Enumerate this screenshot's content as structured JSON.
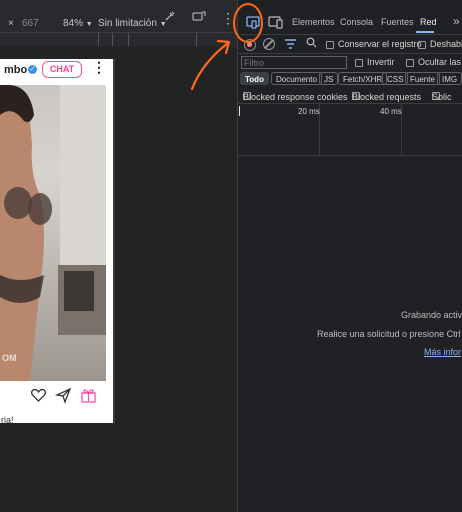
{
  "emulation_bar": {
    "close": "×",
    "width_value": "667",
    "zoom": "84%",
    "zoom_chevron": "▼",
    "throttle": "Sin limitación",
    "throttle_chevron": "▼",
    "more": "⋮"
  },
  "mobile_page": {
    "brand_text": "mbo",
    "chat_button": "CHAT",
    "more": "⋮",
    "watermark": "OM",
    "caption": "ria!",
    "colors": {
      "chat_accent": "#ff4fa3",
      "verified": "#3d8cf0"
    },
    "icons": [
      "heart-icon",
      "send-icon",
      "gift-icon"
    ]
  },
  "devtools": {
    "tabs": [
      {
        "label": "Elementos"
      },
      {
        "label": "Consola"
      },
      {
        "label": "Fuentes"
      },
      {
        "label": "Red",
        "active": true
      }
    ],
    "overflow": "»",
    "toolbar": {
      "preserve_log": "Conservar el registro",
      "disable_cache": "Deshabili"
    },
    "filter": {
      "placeholder": "Filtro",
      "invert": "Invertir",
      "hide": "Ocultar las U"
    },
    "type_chips": [
      "Todo",
      "Documento",
      "JS",
      "Fetch/XHR",
      "CSS",
      "Fuente",
      "IMG"
    ],
    "blocked_row": [
      "Blocked response cookies",
      "Blocked requests",
      "Solic"
    ],
    "timeline_labels": [
      "20 ms",
      "40 ms"
    ],
    "empty_state": {
      "line1": "Grabando activ",
      "line2": "Realice una solicitud o presione Ctrl",
      "link": "Más infor"
    },
    "accent": "#8ab4f8"
  },
  "annotation_color": "#ff6a1a"
}
